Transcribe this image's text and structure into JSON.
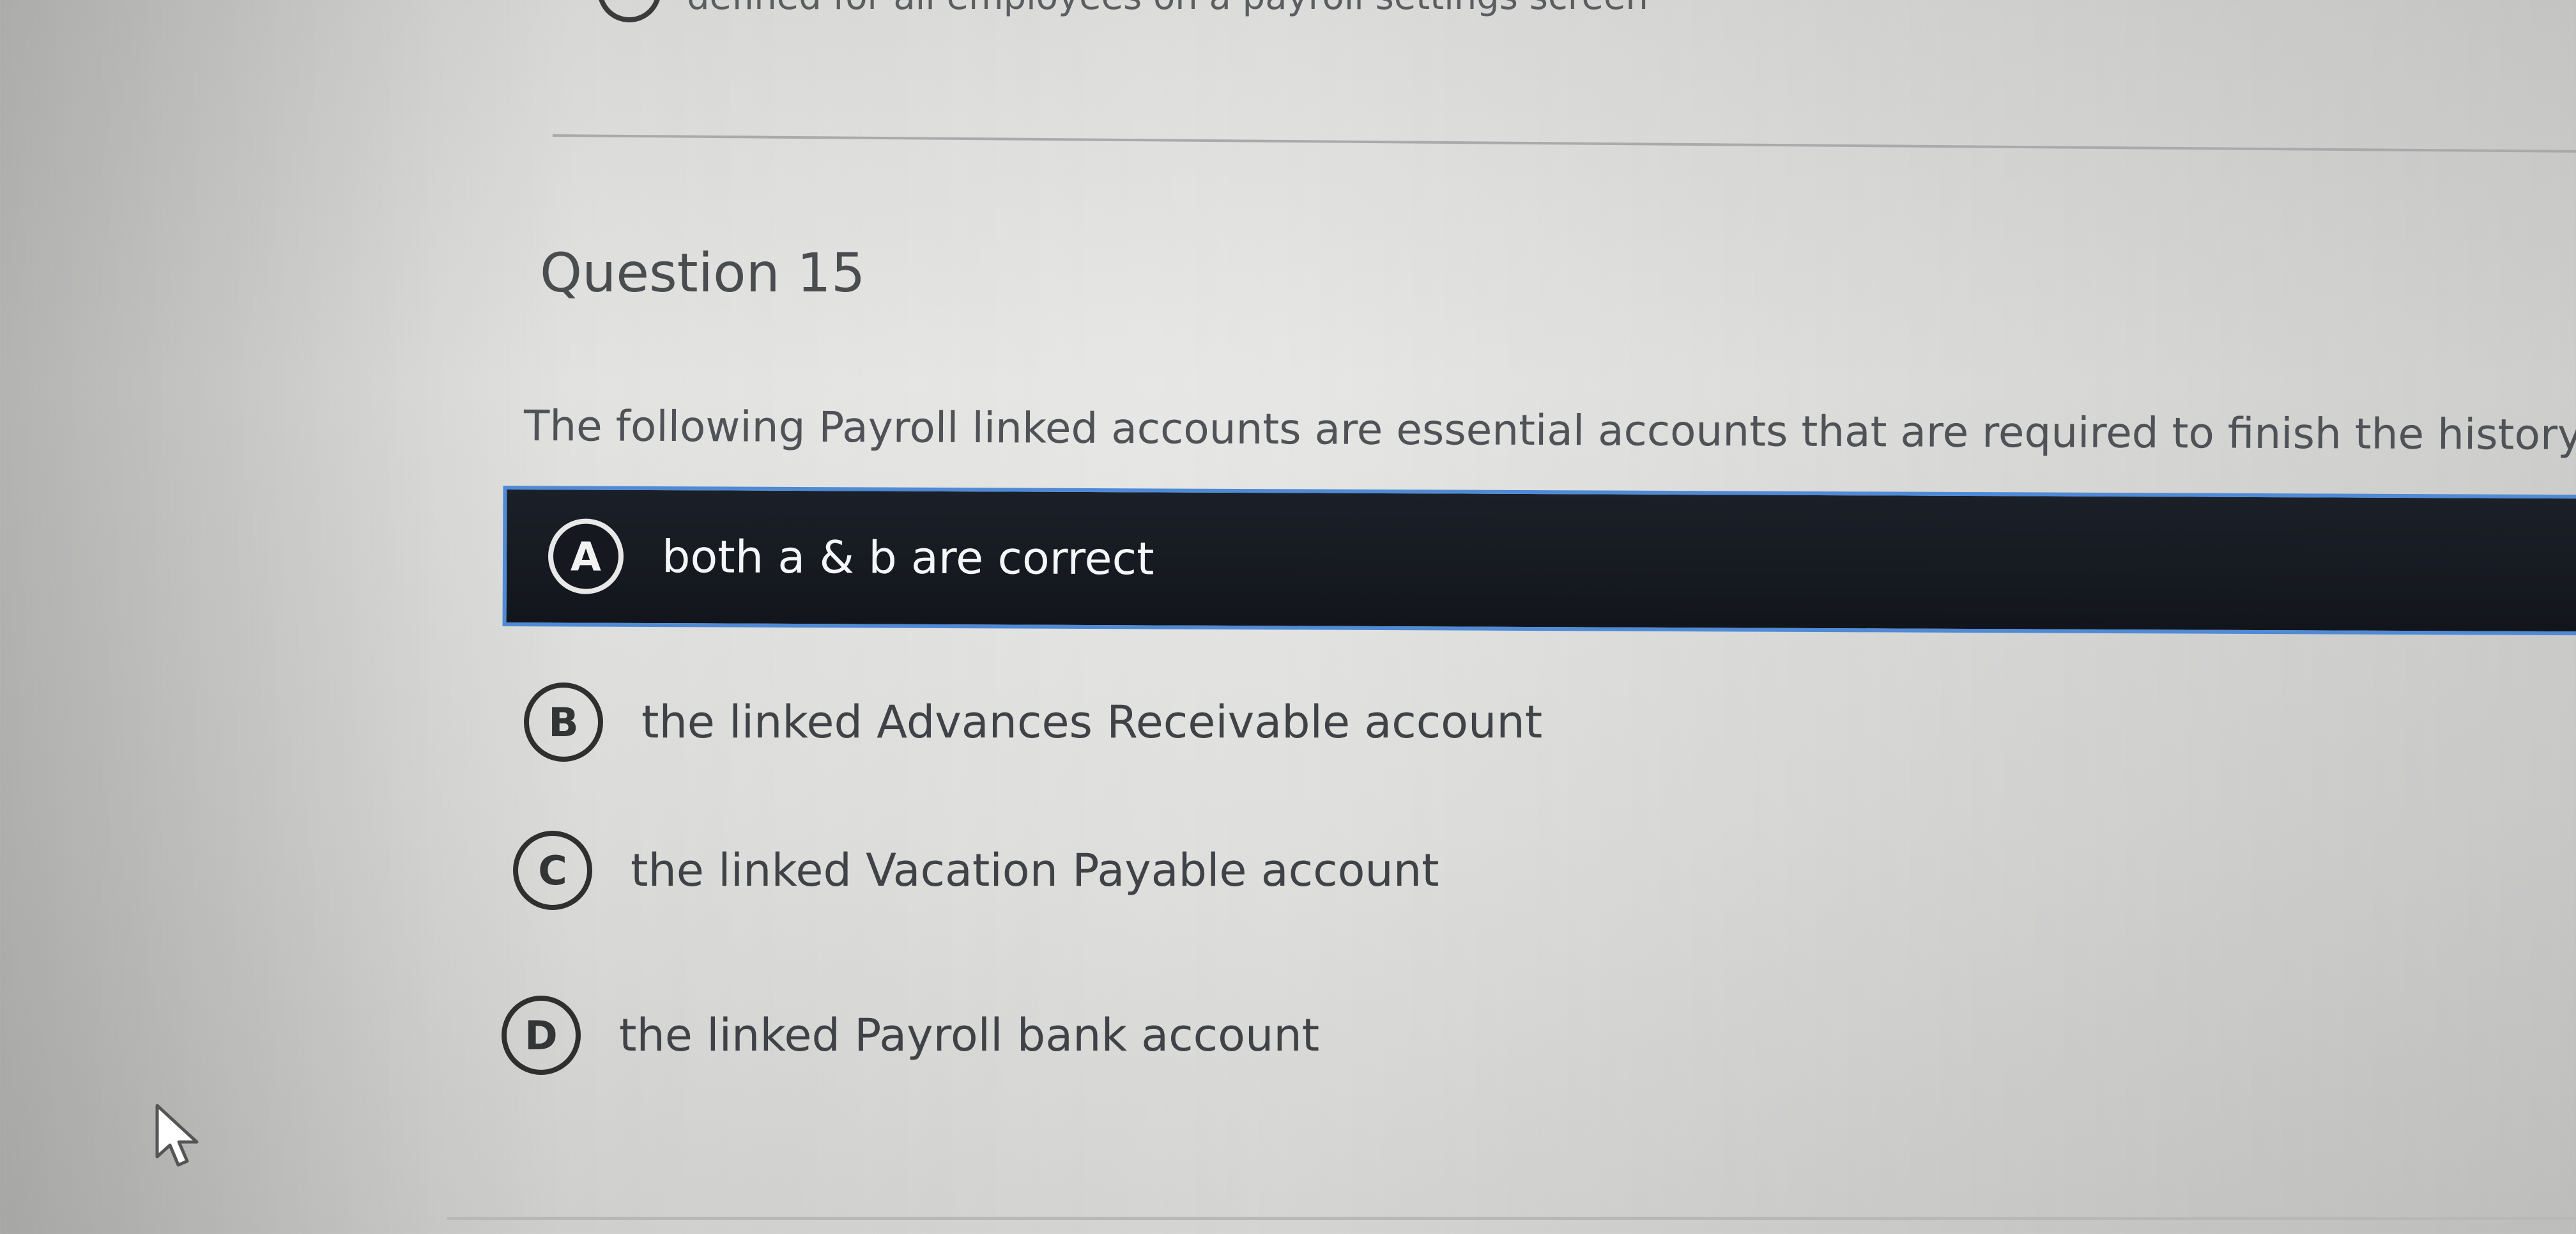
{
  "previous_option": {
    "text": "defined for all employees on a payroll settings screen"
  },
  "question": {
    "title": "Question 15",
    "prompt": "The following Payroll linked accounts are essential accounts that are required to finish the history -"
  },
  "options": [
    {
      "letter": "A",
      "label": "both a & b are correct",
      "selected": true
    },
    {
      "letter": "B",
      "label": "the linked Advances Receivable account",
      "selected": false
    },
    {
      "letter": "C",
      "label": "the linked Vacation Payable account",
      "selected": false
    },
    {
      "letter": "D",
      "label": "the linked Payroll bank account",
      "selected": false
    }
  ],
  "colors": {
    "selected_background": "#15191f",
    "selected_border": "#4f8ad6",
    "text": "#4f5256",
    "badge_border": "#2f2f30"
  },
  "icons": {
    "cursor": "mouse-pointer-icon"
  }
}
